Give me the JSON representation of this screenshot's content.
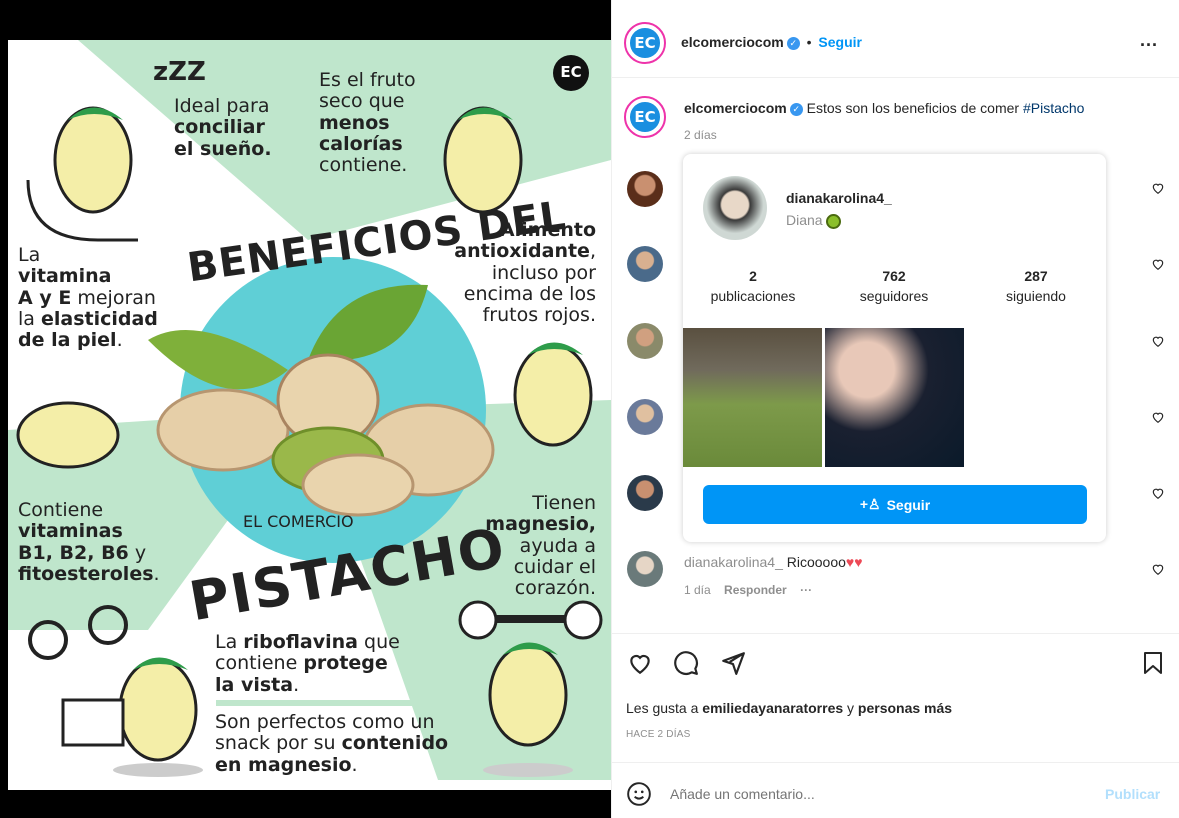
{
  "poster": {
    "logo": "EC",
    "title_top": "BENEFICIOS DEL",
    "title_bottom": "PISTACHO",
    "brand": "EL COMERCIO",
    "sleep": {
      "l1": "Ideal para",
      "l2": "conciliar",
      "l3": "el sueño."
    },
    "fruit": {
      "l1": "Es el fruto",
      "l2": "seco que",
      "l3": "menos",
      "l4": "calorías",
      "l5": "contiene."
    },
    "skin": {
      "l1": "La",
      "l2": "vitamina",
      "l3a": "A y E",
      "l3b": " mejoran",
      "l4a": "la ",
      "l4b": "elasticidad",
      "l5": "de la piel",
      "l5b": "."
    },
    "anti": {
      "l1": "Alimento",
      "l2": "antioxidante",
      "l2b": ",",
      "l3": "incluso por",
      "l4": "encima de los",
      "l5": "frutos rojos."
    },
    "vit": {
      "l1": "Contiene",
      "l2": "vitaminas",
      "l3a": "B1, B2, B6",
      "l3b": " y",
      "l4": "fitoesteroles",
      "l4b": "."
    },
    "mag": {
      "l1": "Tienen",
      "l2": "magnesio,",
      "l3": "ayuda a",
      "l4": "cuidar el",
      "l5": "corazón."
    },
    "ribo": {
      "l1a": "La ",
      "l1b": "riboflavina",
      "l1c": " que",
      "l2a": "contiene ",
      "l2b": "protege",
      "l3a": "la vista",
      "l3b": "."
    },
    "snack": {
      "l1": "Son perfectos como un",
      "l2a": "snack por su ",
      "l2b": "contenido",
      "l3a": "en magnesio",
      "l3b": "."
    }
  },
  "header": {
    "avatar": "EC",
    "username": "elcomerciocom",
    "dot": "•",
    "follow": "Seguir",
    "more": "..."
  },
  "caption": {
    "avatar": "EC",
    "username": "elcomerciocom",
    "text": "Estos son los beneficios de comer ",
    "hashtag": "#Pistacho",
    "time": "2 días"
  },
  "popover": {
    "username": "dianakarolina4_",
    "name": "Diana",
    "stats": [
      {
        "n": "2",
        "l": "publicaciones"
      },
      {
        "n": "762",
        "l": "seguidores"
      },
      {
        "n": "287",
        "l": "siguiendo"
      }
    ],
    "follow": "Seguir"
  },
  "comment": {
    "username": "dianakarolina4_",
    "text": "Ricooooo",
    "emoji": "♥♥",
    "time": "1 día",
    "reply": "Responder",
    "more": "···"
  },
  "likes": {
    "prefix": "Les gusta a ",
    "user": "emiliedayanaratorres",
    "mid": " y ",
    "rest": "personas más"
  },
  "posted": "HACE 2 DÍAS",
  "add_comment": {
    "placeholder": "Añade un comentario...",
    "publish": "Publicar"
  },
  "colors": {
    "mint": "#bfe6cc",
    "teal": "#5fcfd6",
    "blue": "#0095f6",
    "red": "#ed4956"
  }
}
